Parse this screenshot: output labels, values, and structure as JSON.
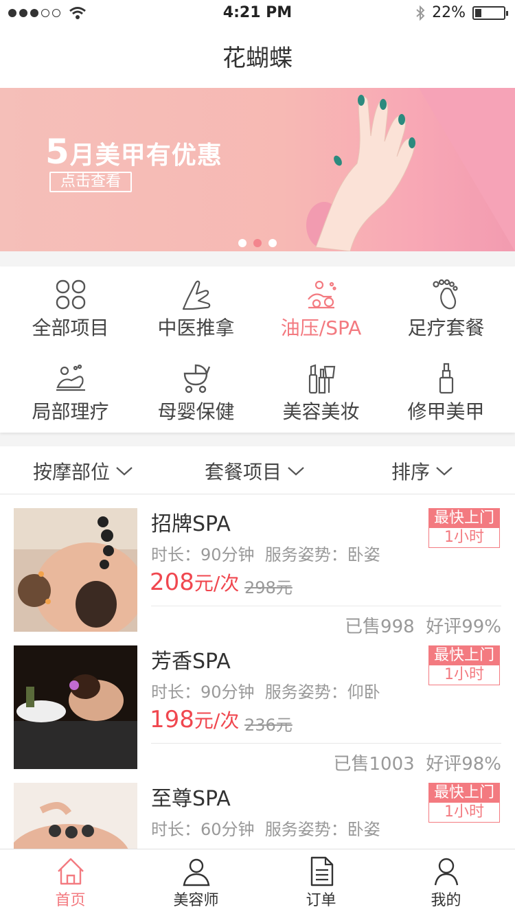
{
  "status_bar": {
    "time": "4:21 PM",
    "battery": "22%",
    "battery_level": 0.22
  },
  "header": {
    "title": "花蝴蝶"
  },
  "banner": {
    "headline_prefix": "5",
    "headline_rest": "月美甲有优惠",
    "cta": "点击查看",
    "dots_count": 3,
    "active_dot": 2
  },
  "categories": [
    {
      "label": "全部项目",
      "icon": "grid-icon"
    },
    {
      "label": "中医推拿",
      "icon": "hand-icon"
    },
    {
      "label": "油压/SPA",
      "icon": "spa-icon",
      "active": true
    },
    {
      "label": "足疗套餐",
      "icon": "foot-icon"
    },
    {
      "label": "局部理疗",
      "icon": "therapy-icon"
    },
    {
      "label": "母婴保健",
      "icon": "stroller-icon"
    },
    {
      "label": "美容美妆",
      "icon": "cosmetics-icon"
    },
    {
      "label": "修甲美甲",
      "icon": "nail-polish-icon"
    }
  ],
  "filters": [
    "按摩部位",
    "套餐项目",
    "排序"
  ],
  "items": [
    {
      "name": "招牌SPA",
      "meta": "时长：90分钟  服务姿势：卧姿",
      "price": "208",
      "unit": "元/次",
      "orig": "298元",
      "badge_top": "最快上门",
      "badge_bottom": "1小时",
      "sold": "已售998",
      "rating": "好评99%"
    },
    {
      "name": "芳香SPA",
      "meta": "时长：90分钟  服务姿势：仰卧",
      "price": "198",
      "unit": "元/次",
      "orig": "236元",
      "badge_top": "最快上门",
      "badge_bottom": "1小时",
      "sold": "已售1003",
      "rating": "好评98%"
    },
    {
      "name": "至尊SPA",
      "meta": "时长：60分钟  服务姿势：卧姿",
      "price": "",
      "unit": "",
      "orig": "",
      "badge_top": "最快上门",
      "badge_bottom": "1小时",
      "sold": "",
      "rating": ""
    }
  ],
  "tabs": [
    {
      "label": "首页",
      "icon": "home-icon",
      "active": true
    },
    {
      "label": "美容师",
      "icon": "beautician-icon"
    },
    {
      "label": "订单",
      "icon": "order-icon"
    },
    {
      "label": "我的",
      "icon": "profile-icon"
    }
  ],
  "colors": {
    "accent": "#f37a80",
    "price": "#f0474f",
    "banner": "#f7b9b4"
  }
}
